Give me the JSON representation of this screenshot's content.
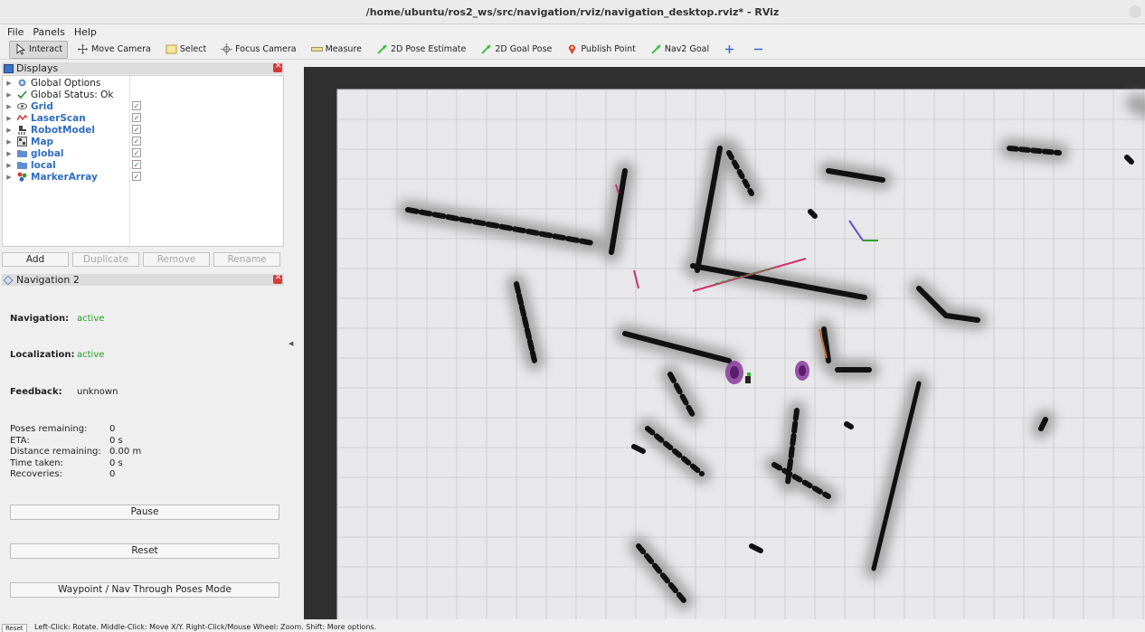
{
  "window": {
    "title": "/home/ubuntu/ros2_ws/src/navigation/rviz/navigation_desktop.rviz* - RViz"
  },
  "menu": [
    "File",
    "Panels",
    "Help"
  ],
  "toolbar": {
    "tools": [
      {
        "label": "Interact",
        "icon": "cursor-icon",
        "active": true
      },
      {
        "label": "Move Camera",
        "icon": "move-camera-icon"
      },
      {
        "label": "Select",
        "icon": "select-icon"
      },
      {
        "label": "Focus Camera",
        "icon": "focus-icon"
      },
      {
        "label": "Measure",
        "icon": "ruler-icon"
      },
      {
        "label": "2D Pose Estimate",
        "icon": "green-arrow-icon"
      },
      {
        "label": "2D Goal Pose",
        "icon": "green-arrow-icon"
      },
      {
        "label": "Publish Point",
        "icon": "map-pin-icon"
      },
      {
        "label": "Nav2 Goal",
        "icon": "green-arrow-icon"
      }
    ],
    "accent_green": "#2dbb2d",
    "accent_red": "#d84a2a"
  },
  "displays": {
    "title": "Displays",
    "items": [
      {
        "label": "Global Options",
        "icon": "gear-icon",
        "checkbox": false,
        "style": "plain"
      },
      {
        "label": "Global Status: Ok",
        "icon": "checkmark-icon",
        "checkbox": false,
        "style": "plain"
      },
      {
        "label": "Grid",
        "icon": "grid-icon",
        "checkbox": true,
        "style": "blue"
      },
      {
        "label": "LaserScan",
        "icon": "laser-icon",
        "checkbox": true,
        "style": "blue"
      },
      {
        "label": "RobotModel",
        "icon": "robot-icon",
        "checkbox": true,
        "style": "blue"
      },
      {
        "label": "Map",
        "icon": "map-icon",
        "checkbox": true,
        "style": "blue"
      },
      {
        "label": "global",
        "icon": "folder-icon",
        "checkbox": true,
        "style": "blue"
      },
      {
        "label": "local",
        "icon": "folder-icon",
        "checkbox": true,
        "style": "blue"
      },
      {
        "label": "MarkerArray",
        "icon": "marker-icon",
        "checkbox": true,
        "style": "blue"
      }
    ],
    "buttons": {
      "add": "Add",
      "duplicate": "Duplicate",
      "remove": "Remove",
      "rename": "Rename"
    }
  },
  "navigation": {
    "title": "Navigation 2",
    "navigation_label": "Navigation:",
    "navigation_value": "active",
    "localization_label": "Localization:",
    "localization_value": "active",
    "feedback_label": "Feedback:",
    "feedback_value": "unknown",
    "stats": [
      {
        "label": "Poses remaining:",
        "value": "0"
      },
      {
        "label": "ETA:",
        "value": "0 s"
      },
      {
        "label": "Distance remaining:",
        "value": "0.00 m"
      },
      {
        "label": "Time taken:",
        "value": "0 s"
      },
      {
        "label": "Recoveries:",
        "value": "0"
      }
    ],
    "buttons": {
      "pause": "Pause",
      "reset": "Reset",
      "waypoint": "Waypoint / Nav Through Poses Mode"
    },
    "active_color": "#1fa21f"
  },
  "statusbar": {
    "reset": "Reset",
    "hint": "Left-Click: Rotate. Middle-Click: Move X/Y. Right-Click/Mouse Wheel: Zoom. Shift: More options."
  }
}
